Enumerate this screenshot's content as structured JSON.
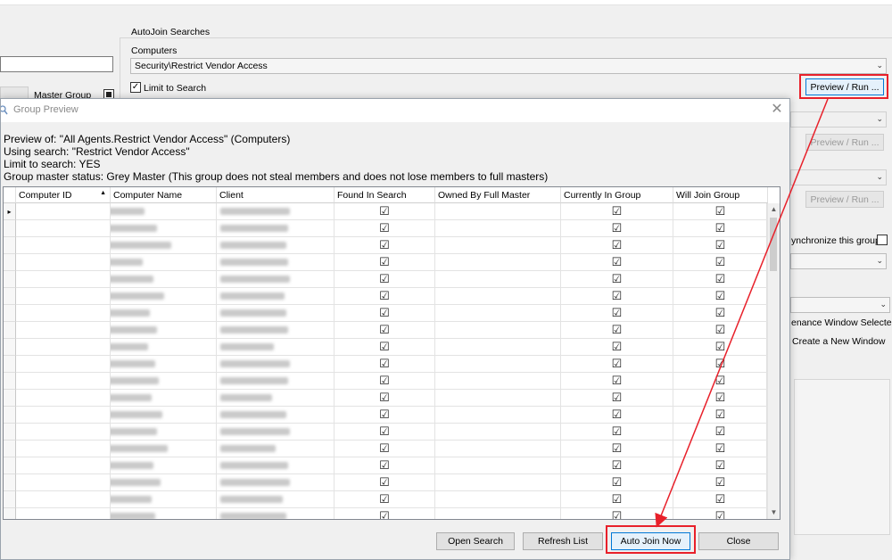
{
  "background": {
    "groupbox_title": "AutoJoin Searches",
    "computers_label": "Computers",
    "computers_value": "Security\\Restrict Vendor Access",
    "limit_to_search_label": "Limit to Search",
    "limit_to_search_checked": true,
    "master_group_label": "Master Group",
    "preview_run_label": "Preview / Run ...",
    "preview_run_disabled_1": "Preview / Run ...",
    "preview_run_disabled_2": "Preview / Run ...",
    "synchronize_label": "ynchronize this group",
    "maint_window_label": "enance Window Selected",
    "create_window_label": "Create a New Window"
  },
  "dialog": {
    "title": "Group Preview",
    "info_lines": [
      "Preview of: \"All Agents.Restrict Vendor Access\" (Computers)",
      "Using search: \"Restrict Vendor Access\"",
      "Limit to search: YES",
      "Group master status: Grey Master (This group does not steal members and does not lose members to full masters)"
    ],
    "columns": [
      "Computer ID",
      "Computer Name",
      "Client",
      "Found In Search",
      "Owned By Full Master",
      "Currently In Group",
      "Will Join Group"
    ],
    "sort_indicator": "▲",
    "current_row_indicator": "▸",
    "check_glyph": "☑",
    "row_count": 19,
    "rows_found_in_search": true,
    "rows_owned_by_full_master": false,
    "rows_currently_in_group": true,
    "rows_will_join_group": true,
    "buttons": {
      "open_search": "Open Search",
      "refresh_list": "Refresh List",
      "auto_join_now": "Auto Join Now",
      "close": "Close"
    },
    "close_glyph": "✕"
  },
  "colors": {
    "highlight": "#e8202a",
    "accent": "#0078d7"
  }
}
